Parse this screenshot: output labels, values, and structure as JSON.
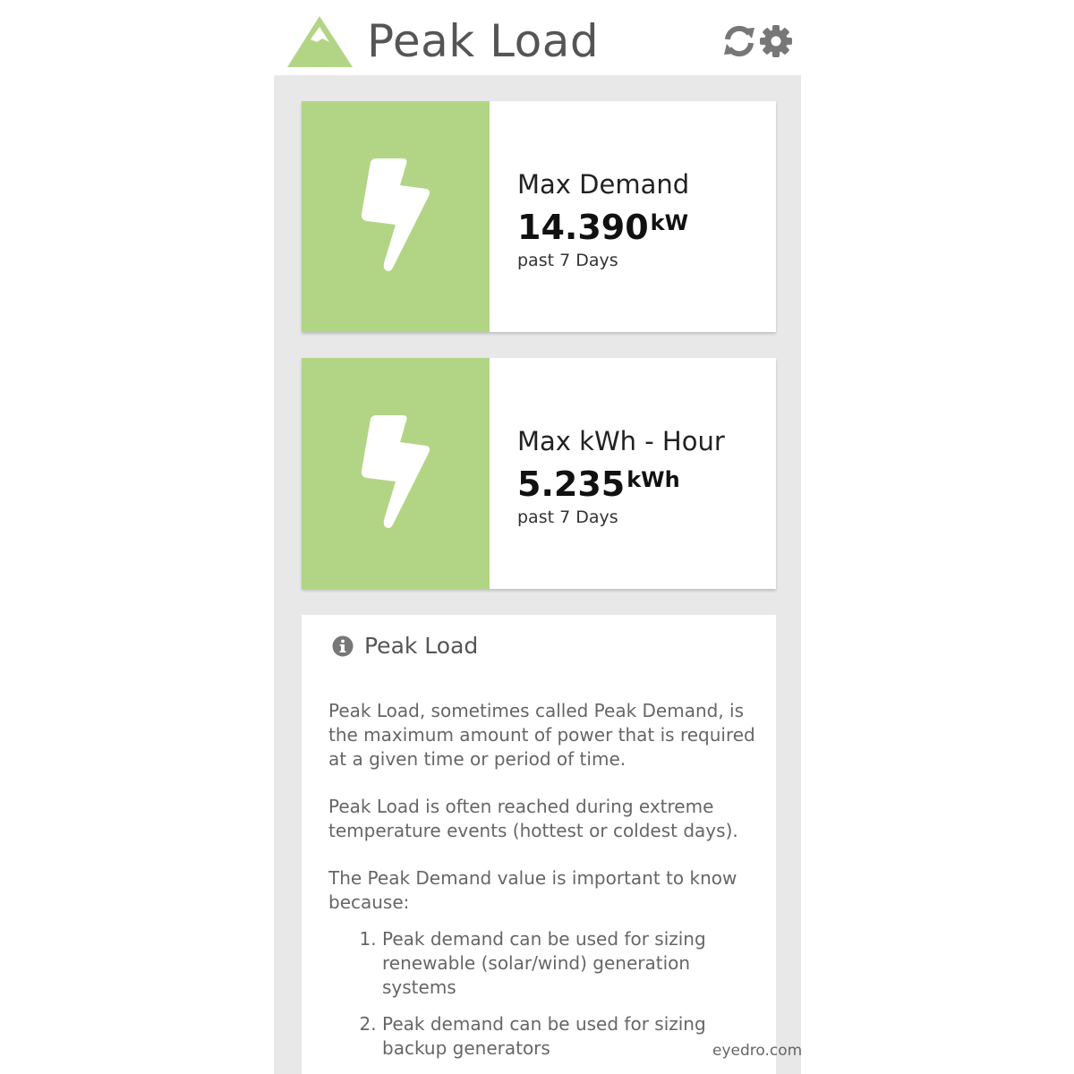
{
  "header": {
    "title": "Peak Load",
    "logo_icon": "mountain-logo-icon",
    "refresh_icon": "refresh-icon",
    "settings_icon": "gear-icon"
  },
  "colors": {
    "accent": "#b2d585",
    "panel_bg": "#e8e8e8",
    "title_text": "#555555"
  },
  "metrics": [
    {
      "label": "Max Demand",
      "value": "14.390",
      "unit": "kW",
      "period": "past 7 Days",
      "icon": "lightning-bolt-icon"
    },
    {
      "label": "Max kWh - Hour",
      "value": "5.235",
      "unit": "kWh",
      "period": "past 7 Days",
      "icon": "lightning-bolt-icon"
    }
  ],
  "info": {
    "icon": "info-icon",
    "title": "Peak Load",
    "paragraphs": [
      "Peak Load, sometimes called Peak Demand, is the maximum amount of power that is required at a given time or period of time.",
      "Peak Load is often reached during extreme temperature events (hottest or coldest days).",
      "The Peak Demand value is important to know because:"
    ],
    "list": [
      "Peak demand can be used for sizing renewable (solar/wind) generation systems",
      "Peak demand can be used for sizing backup generators"
    ]
  },
  "watermark": "eyedro.com"
}
